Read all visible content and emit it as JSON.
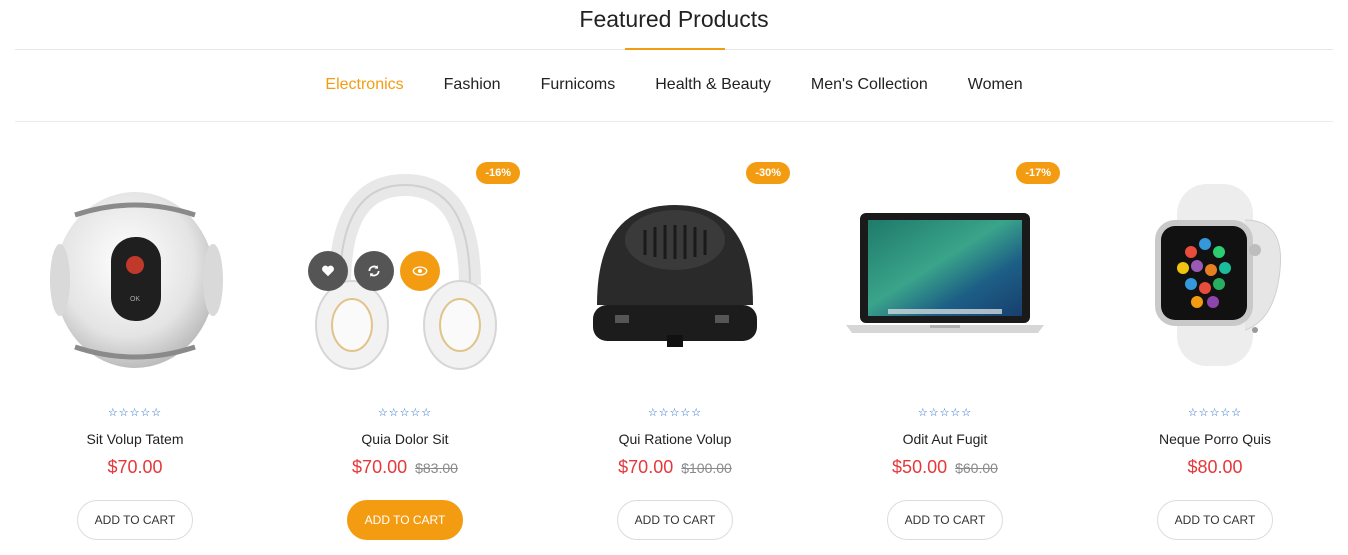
{
  "section": {
    "title": "Featured Products"
  },
  "tabs": [
    {
      "label": "Electronics",
      "active": true
    },
    {
      "label": "Fashion",
      "active": false
    },
    {
      "label": "Furnicoms",
      "active": false
    },
    {
      "label": "Health & Beauty",
      "active": false
    },
    {
      "label": "Men's Collection",
      "active": false
    },
    {
      "label": "Women",
      "active": false
    }
  ],
  "colors": {
    "accent": "#f39c12",
    "price": "#e5383b",
    "star": "#1f66c1"
  },
  "products": [
    {
      "name": "Sit Volup Tatem",
      "price": "$70.00",
      "old_price": "",
      "badge": "",
      "stars": "☆☆☆☆☆",
      "cart_label": "ADD TO CART",
      "image": "360-camera"
    },
    {
      "name": "Quia Dolor Sit",
      "price": "$70.00",
      "old_price": "$83.00",
      "badge": "-16%",
      "stars": "☆☆☆☆☆",
      "cart_label": "ADD TO CART",
      "image": "headphones"
    },
    {
      "name": "Qui Ratione Volup",
      "price": "$70.00",
      "old_price": "$100.00",
      "badge": "-30%",
      "stars": "☆☆☆☆☆",
      "cart_label": "ADD TO CART",
      "image": "vr-device"
    },
    {
      "name": "Odit Aut Fugit",
      "price": "$50.00",
      "old_price": "$60.00",
      "badge": "-17%",
      "stars": "☆☆☆☆☆",
      "cart_label": "ADD TO CART",
      "image": "laptop"
    },
    {
      "name": "Neque Porro Quis",
      "price": "$80.00",
      "old_price": "",
      "badge": "",
      "stars": "☆☆☆☆☆",
      "cart_label": "ADD TO CART",
      "image": "smartwatch"
    }
  ],
  "hover_actions": [
    "heart-icon",
    "compare-icon",
    "quick-view-icon"
  ]
}
